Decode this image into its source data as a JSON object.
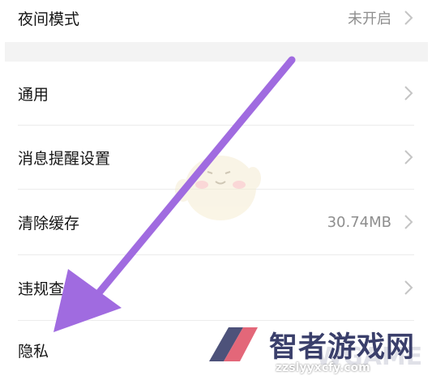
{
  "settings": {
    "items": [
      {
        "label": "夜间模式",
        "value": "未开启"
      },
      {
        "label": "通用",
        "value": ""
      },
      {
        "label": "消息提醒设置",
        "value": ""
      },
      {
        "label": "清除缓存",
        "value": "30.74MB"
      },
      {
        "label": "违规查询",
        "value": ""
      },
      {
        "label": "隐私",
        "value": ""
      }
    ]
  },
  "watermark": {
    "name": "智者游戏网",
    "url": "zzslyyxcfy.com",
    "ghost_text": "WGAME"
  },
  "icons": [
    "chevron-right-icon",
    "annotation-arrow",
    "mascot-sticker",
    "watermark-logo"
  ],
  "colors": {
    "arrow": "#a06be0",
    "text": "#151515",
    "value": "#8e8e8e",
    "chevron": "#c4c4c4"
  }
}
